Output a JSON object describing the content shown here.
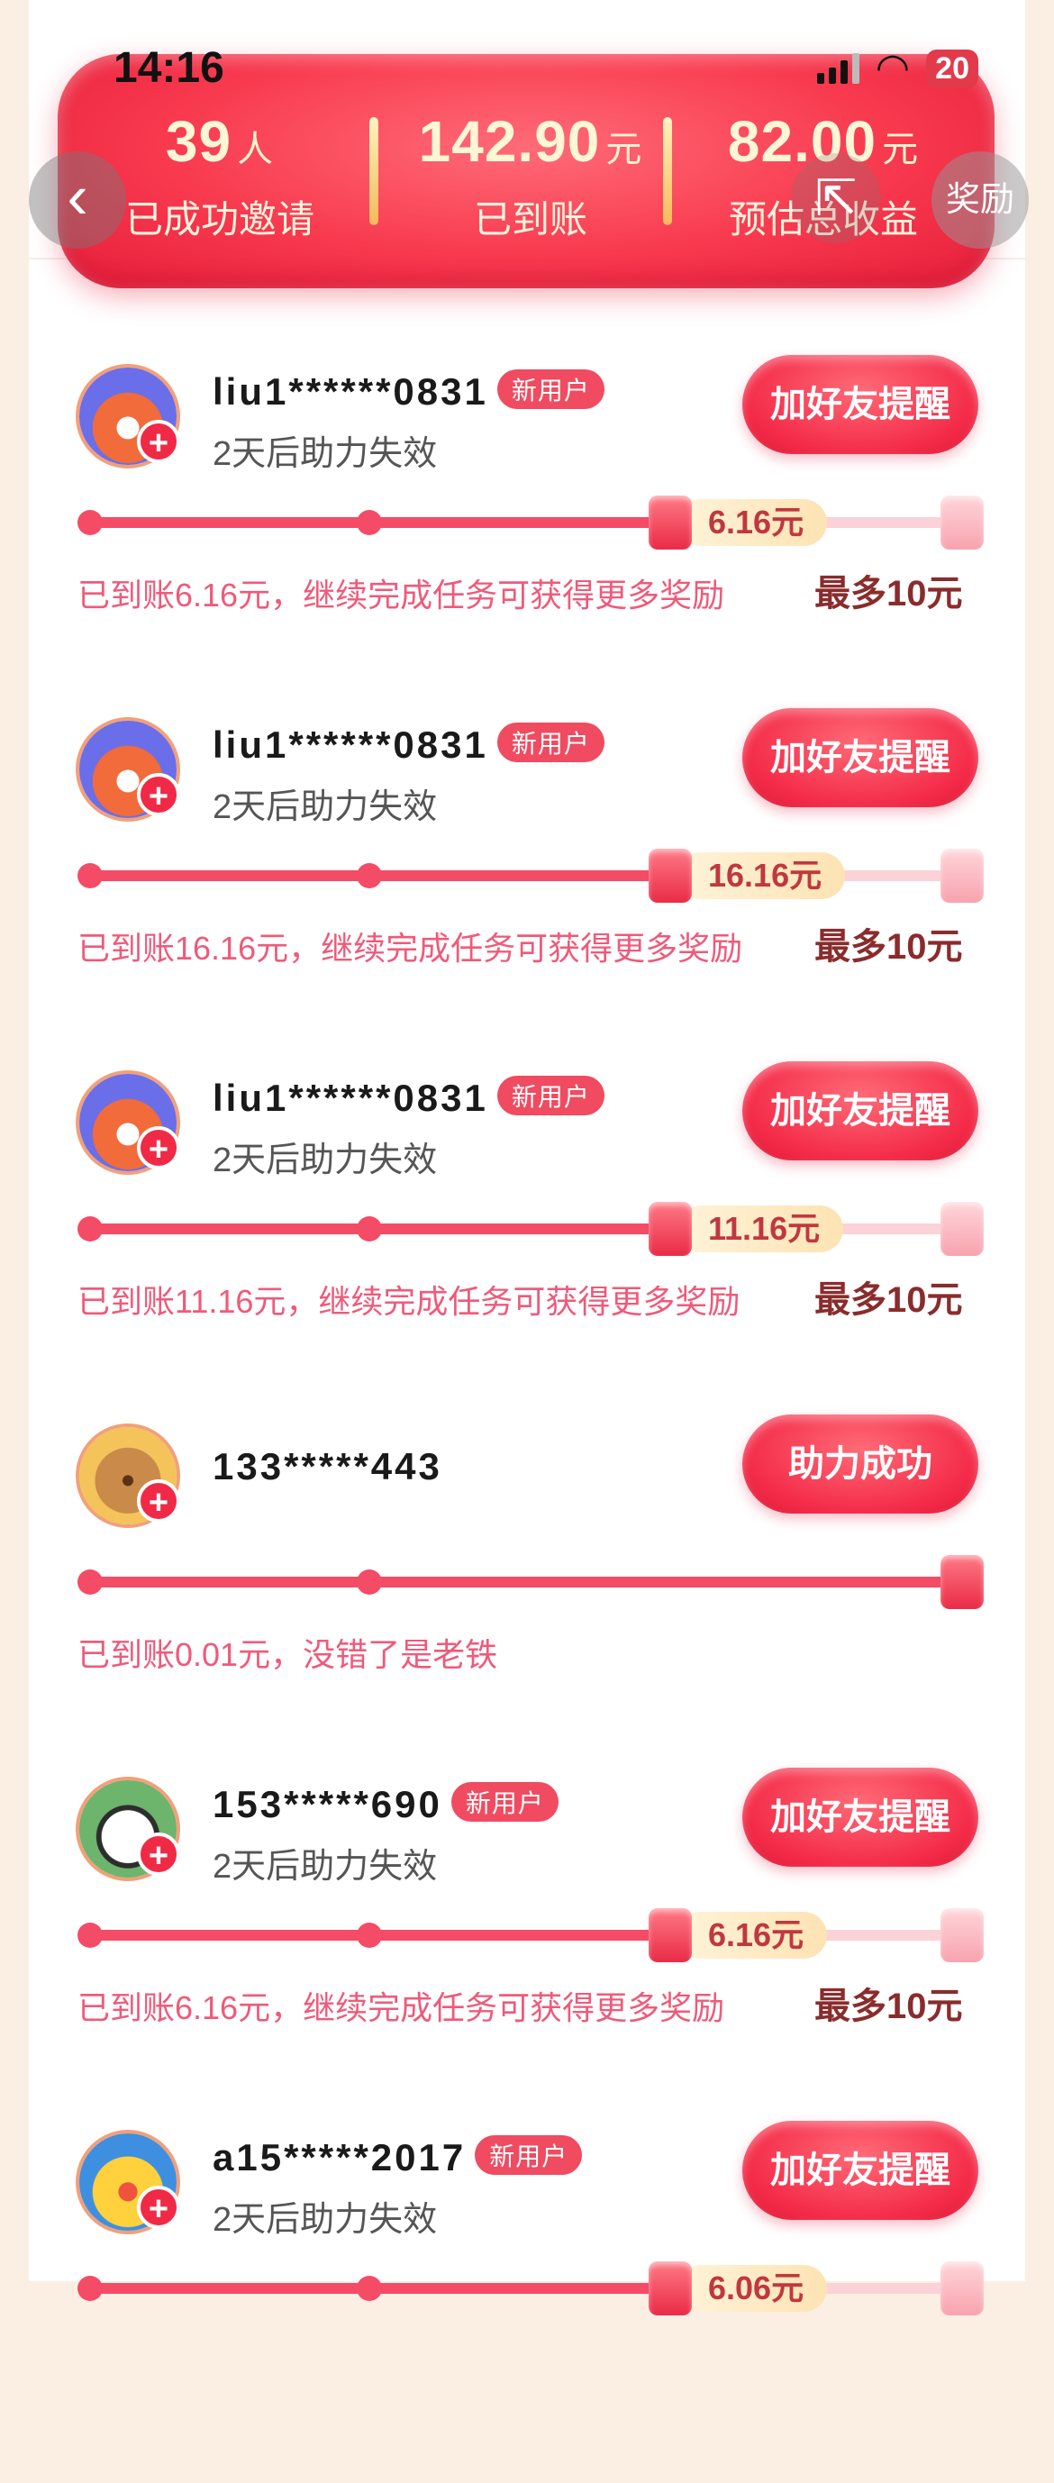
{
  "status_bar": {
    "time": "14:16",
    "battery": "20"
  },
  "header": {
    "stats": [
      {
        "value": "39",
        "unit": "人",
        "label": "已成功邀请"
      },
      {
        "value": "142.90",
        "unit": "元",
        "label": "已到账"
      },
      {
        "value": "82.00",
        "unit": "元",
        "label": "预估总收益"
      }
    ],
    "back_icon": "chevron-left-icon",
    "share_icon": "share-icon",
    "reward_label": "奖励"
  },
  "invitees": [
    {
      "name": "liu1******0831",
      "tag": "新用户",
      "sub": "2天后助力失效",
      "action": "加好友提醒",
      "amount": "6.16元",
      "progress": 0.65,
      "note": "已到账6.16元，继续完成任务可获得更多奖励",
      "max": "最多10元",
      "avatar": "fox-avatar"
    },
    {
      "name": "liu1******0831",
      "tag": "新用户",
      "sub": "2天后助力失效",
      "action": "加好友提醒",
      "amount": "16.16元",
      "progress": 0.65,
      "note": "已到账16.16元，继续完成任务可获得更多奖励",
      "max": "最多10元",
      "avatar": "fox-avatar"
    },
    {
      "name": "liu1******0831",
      "tag": "新用户",
      "sub": "2天后助力失效",
      "action": "加好友提醒",
      "amount": "11.16元",
      "progress": 0.65,
      "note": "已到账11.16元，继续完成任务可获得更多奖励",
      "max": "最多10元",
      "avatar": "fox-avatar"
    },
    {
      "name": "133*****443",
      "tag": "",
      "sub": "",
      "action": "助力成功",
      "amount": "",
      "progress": 1.0,
      "note": "已到账0.01元，没错了是老铁",
      "max": "",
      "avatar": "dog-avatar"
    },
    {
      "name": "153*****690",
      "tag": "新用户",
      "sub": "2天后助力失效",
      "action": "加好友提醒",
      "amount": "6.16元",
      "progress": 0.65,
      "note": "已到账6.16元，继续完成任务可获得更多奖励",
      "max": "最多10元",
      "avatar": "panda-avatar"
    },
    {
      "name": "a15*****2017",
      "tag": "新用户",
      "sub": "2天后助力失效",
      "action": "加好友提醒",
      "amount": "6.06元",
      "progress": 0.65,
      "note": "",
      "max": "",
      "avatar": "duck-avatar"
    }
  ],
  "colors": {
    "accent": "#f42b48",
    "progress": "#f44b66",
    "note": "#ef5a7a",
    "page_bg": "#fbeee3"
  }
}
